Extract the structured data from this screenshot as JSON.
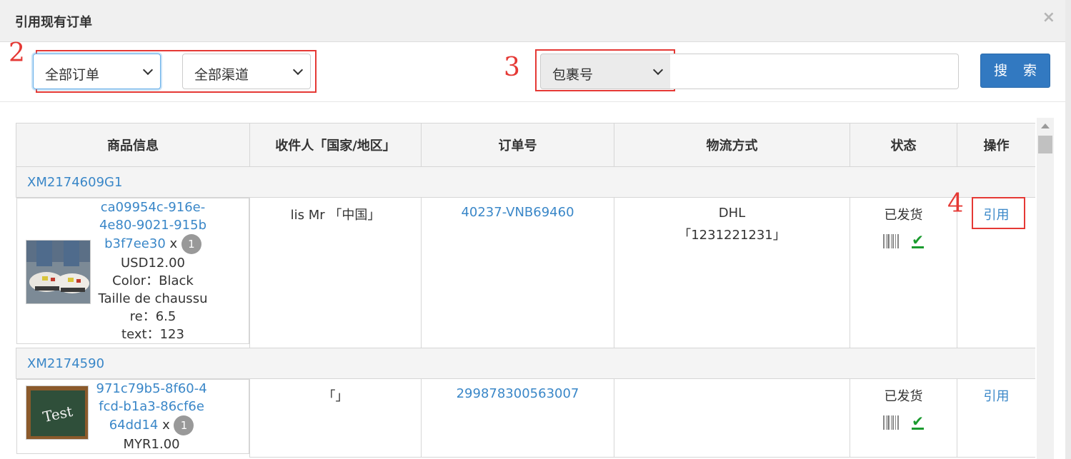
{
  "dialog": {
    "title": "引用现有订单",
    "close_glyph": "×"
  },
  "annotations": {
    "a2": "2",
    "a3": "3",
    "a4": "4"
  },
  "filters": {
    "order_scope": "全部订单",
    "channel": "全部渠道",
    "search_field": "包裹号",
    "search_value": "",
    "search_button": "搜 索"
  },
  "table": {
    "headers": {
      "product": "商品信息",
      "recipient": "收件人「国家/地区」",
      "order_no": "订单号",
      "logistics": "物流方式",
      "status": "状态",
      "action": "操作"
    },
    "groups": [
      {
        "group_id": "XM2174609G1",
        "sku": "ca09954c-916e-4e80-9021-915bb3f7ee30",
        "sku_lines": [
          "ca09954c-916e-",
          "4e80-9021-915b",
          "b3f7ee30"
        ],
        "qty": "1",
        "qty_prefix": "x",
        "price": "USD12.00",
        "attrs": [
          "Color：Black",
          "Taille de chaussu",
          "re：6.5",
          "text：123"
        ],
        "recipient": "lis Mr 「中国」",
        "order_no": "40237-VNB69460",
        "logistics": "DHL",
        "tracking": "「1231221231」",
        "status": "已发货",
        "action": "引用"
      },
      {
        "group_id": "XM2174590",
        "sku": "971c79b5-8f60-4fcd-b1a3-86cf6e64dd14",
        "sku_lines": [
          "971c79b5-8f60-4",
          "fcd-b1a3-86cf6e",
          "64dd14"
        ],
        "qty": "1",
        "qty_prefix": "x",
        "price": "MYR1.00",
        "thumb_text": "Test",
        "recipient": "「」",
        "order_no": "299878300563007",
        "logistics": "",
        "tracking": "",
        "status": "已发货",
        "action": "引用"
      }
    ]
  },
  "colors": {
    "accent": "#3279c1",
    "link": "#3a87c8",
    "annotation": "#e53935",
    "check": "#1a9b2e"
  }
}
